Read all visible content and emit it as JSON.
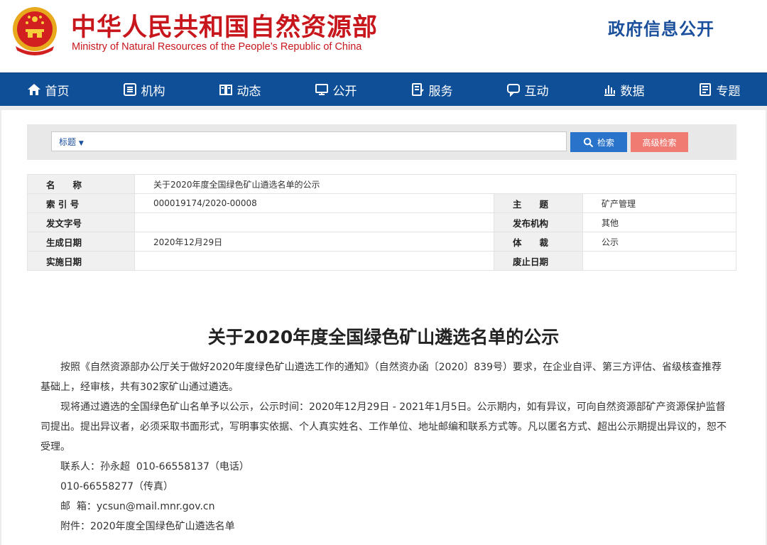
{
  "header": {
    "site_title": "中华人民共和国自然资源部",
    "site_subtitle": "Ministry of Natural Resources of the People’s Republic of China",
    "section": "政府信息公开",
    "brand_color": "#c8161d",
    "emblem_icon": "national-emblem-icon"
  },
  "nav": {
    "color": "#0f4f98",
    "items": [
      {
        "label": "首页",
        "icon": "home-icon"
      },
      {
        "label": "机构",
        "icon": "organization-icon"
      },
      {
        "label": "动态",
        "icon": "news-icon"
      },
      {
        "label": "公开",
        "icon": "monitor-icon"
      },
      {
        "label": "服务",
        "icon": "service-icon"
      },
      {
        "label": "互动",
        "icon": "chat-icon"
      },
      {
        "label": "数据",
        "icon": "chart-icon"
      },
      {
        "label": "专题",
        "icon": "topic-icon"
      }
    ]
  },
  "search": {
    "type_label": "标题",
    "input_value": "",
    "search_button": "检索",
    "advanced_button": "高级检索"
  },
  "meta": {
    "name_label": "名　　称",
    "name_value": "关于2020年度全国绿色矿山遴选名单的公示",
    "index_label": "索 引 号",
    "index_value": "000019174/2020-00008",
    "subject_label": "主　　题",
    "subject_value": "矿产管理",
    "docno_label": "发文字号",
    "docno_value": "",
    "issuer_label": "发布机构",
    "issuer_value": "其他",
    "created_label": "生成日期",
    "created_value": "2020年12月29日",
    "genre_label": "体　　裁",
    "genre_value": "公示",
    "effective_label": "实施日期",
    "effective_value": "",
    "expiry_label": "废止日期",
    "expiry_value": ""
  },
  "article": {
    "title": "关于2020年度全国绿色矿山遴选名单的公示",
    "p1": "按照《自然资源部办公厅关于做好2020年度绿色矿山遴选工作的通知》（自然资办函〔2020〕839号）要求，在企业自评、第三方评估、省级核查推荐基础上，经审核，共有302家矿山通过遴选。",
    "p2": "现将通过遴选的全国绿色矿山名单予以公示，公示时间：2020年12月29日 - 2021年1月5日。公示期内，如有异议，可向自然资源部矿产资源保护监督司提出。提出异议者，必须采取书面形式，写明事实依据、个人真实姓名、工作单位、地址邮编和联系方式等。凡以匿名方式、超出公示期提出异议的，恕不受理。",
    "contact": "联系人：孙永超  010-66558137（电话）",
    "fax": "010-66558277（传真）",
    "email": "邮  箱：ycsun@mail.mnr.gov.cn",
    "attachment": "附件：2020年度全国绿色矿山遴选名单"
  }
}
